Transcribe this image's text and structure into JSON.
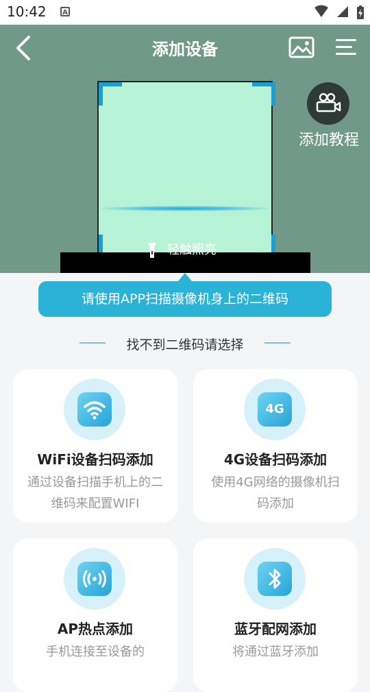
{
  "status_bar": {
    "time": "10:42",
    "notification_icon": "A"
  },
  "header": {
    "title": "添加设备"
  },
  "tutorial": {
    "label": "添加教程"
  },
  "scanner": {
    "torch_label": "轻触照亮"
  },
  "tip": {
    "text": "请使用APP扫描摄像机身上的二维码"
  },
  "section": {
    "title": "找不到二维码请选择"
  },
  "options": [
    {
      "title": "WiFi设备扫码添加",
      "desc": "通过设备扫描手机上的二维码来配置WIFI",
      "icon": "wifi-icon"
    },
    {
      "title": "4G设备扫码添加",
      "desc": "使用4G网络的摄像机扫码添加",
      "icon": "4g-icon",
      "icon_text": "4G"
    },
    {
      "title": "AP热点添加",
      "desc": "手机连接至设备的",
      "icon": "hotspot-icon"
    },
    {
      "title": "蓝牙配网添加",
      "desc": "将通过蓝牙添加",
      "icon": "bluetooth-icon"
    }
  ],
  "colors": {
    "camera_bg": "#71998a",
    "accent": "#2bb3d7",
    "scan_frame": "#b6f2d6"
  }
}
